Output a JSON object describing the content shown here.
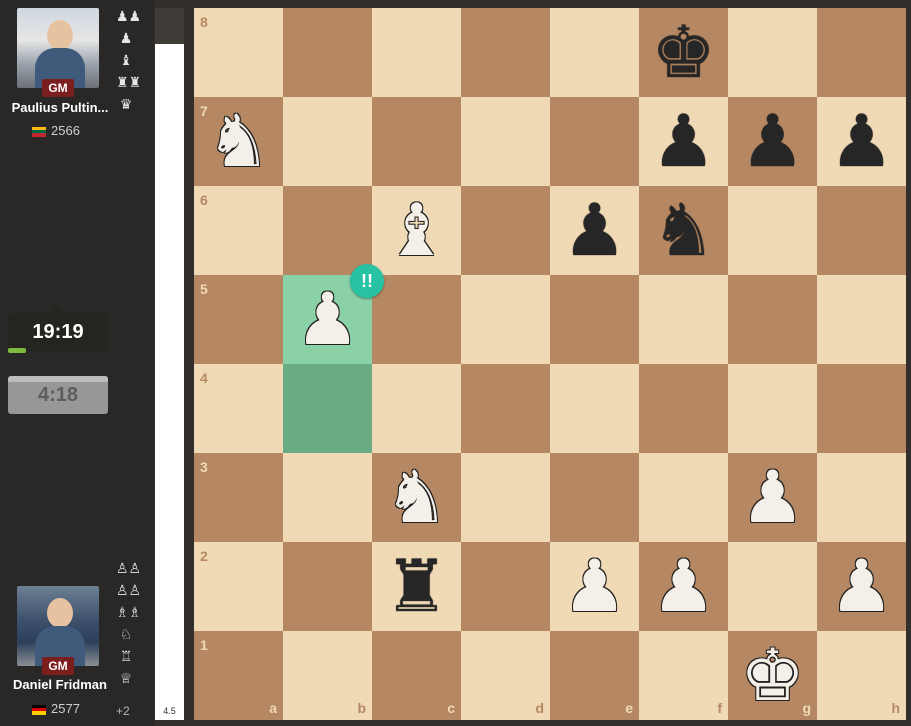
{
  "top_player": {
    "name": "Paulius Pultin...",
    "title": "GM",
    "rating": "2566",
    "flag": [
      "#fdb913",
      "#006a44",
      "#c1272d"
    ],
    "captured": [
      "♟♟",
      "♟",
      "♝",
      "♜♜",
      "♛"
    ]
  },
  "bottom_player": {
    "name": "Daniel Fridman",
    "title": "GM",
    "rating": "2577",
    "flag": [
      "#000000",
      "#dd0000",
      "#ffce00"
    ],
    "captured": [
      "♙♙",
      "♙♙",
      "♗♗",
      "♘",
      "♖",
      "♕"
    ],
    "material_diff": "+2"
  },
  "clocks": {
    "top": "19:19",
    "bottom": "4:18"
  },
  "eval": {
    "score": "4.5"
  },
  "board": {
    "colors": {
      "light": "#f0d9b5",
      "dark": "#b58863",
      "highlight_from": "#6aab84",
      "highlight_to": "#8bd1a8"
    },
    "files": [
      "a",
      "b",
      "c",
      "d",
      "e",
      "f",
      "g",
      "h"
    ],
    "ranks": [
      "8",
      "7",
      "6",
      "5",
      "4",
      "3",
      "2",
      "1"
    ],
    "highlight": {
      "from": "b4",
      "to": "b5"
    },
    "move_annotation": "!!",
    "pieces": [
      {
        "square": "f8",
        "piece": "king",
        "color": "black",
        "glyph": "♚"
      },
      {
        "square": "a7",
        "piece": "knight",
        "color": "white",
        "glyph": "♞"
      },
      {
        "square": "f7",
        "piece": "pawn",
        "color": "black",
        "glyph": "♟"
      },
      {
        "square": "g7",
        "piece": "pawn",
        "color": "black",
        "glyph": "♟"
      },
      {
        "square": "h7",
        "piece": "pawn",
        "color": "black",
        "glyph": "♟"
      },
      {
        "square": "c6",
        "piece": "bishop",
        "color": "white",
        "glyph": "♝"
      },
      {
        "square": "e6",
        "piece": "pawn",
        "color": "black",
        "glyph": "♟"
      },
      {
        "square": "f6",
        "piece": "knight",
        "color": "black",
        "glyph": "♞"
      },
      {
        "square": "b5",
        "piece": "pawn",
        "color": "white",
        "glyph": "♟"
      },
      {
        "square": "c3",
        "piece": "knight",
        "color": "white",
        "glyph": "♞"
      },
      {
        "square": "g3",
        "piece": "pawn",
        "color": "white",
        "glyph": "♟"
      },
      {
        "square": "c2",
        "piece": "rook",
        "color": "black",
        "glyph": "♜"
      },
      {
        "square": "e2",
        "piece": "pawn",
        "color": "white",
        "glyph": "♟"
      },
      {
        "square": "f2",
        "piece": "pawn",
        "color": "white",
        "glyph": "♟"
      },
      {
        "square": "h2",
        "piece": "pawn",
        "color": "white",
        "glyph": "♟"
      },
      {
        "square": "g1",
        "piece": "king",
        "color": "white",
        "glyph": "♚"
      }
    ]
  }
}
